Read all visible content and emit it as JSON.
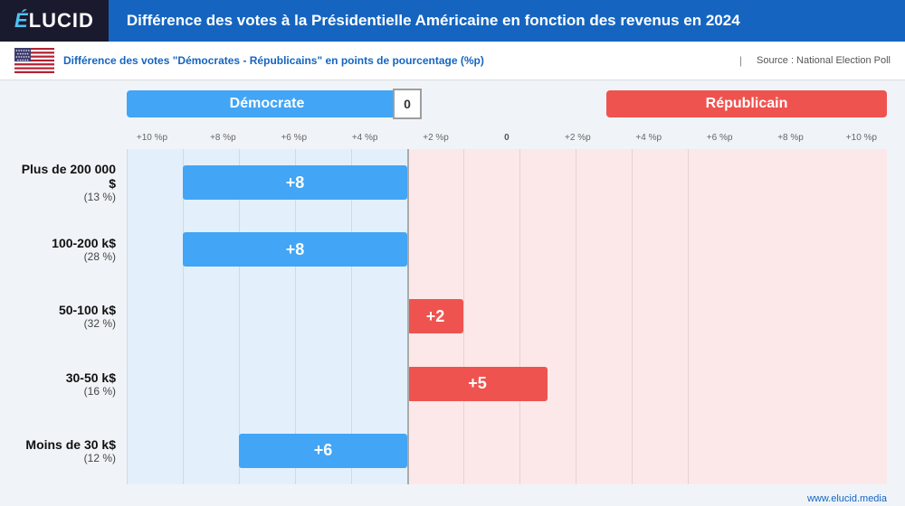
{
  "header": {
    "logo": "ÉLUCID",
    "logo_accent": "É",
    "title": "Différence des votes à la Présidentielle Américaine en fonction des revenus en 2024"
  },
  "subtitle": {
    "text": "Différence des votes \"Démocrates - Républicains\" en points de pourcentage (%p)",
    "source": "Source : National Election Poll"
  },
  "legend": {
    "democrat": "Démocrate",
    "republican": "Républicain",
    "zero": "0"
  },
  "axis": {
    "labels": [
      "+10 %p",
      "+8 %p",
      "+6 %p",
      "+4 %p",
      "+2 %p",
      "0",
      "+2 %p",
      "+4 %p",
      "+6 %p",
      "+8 %p",
      "+10 %p"
    ]
  },
  "bars": [
    {
      "label": "Plus de 200 000 $",
      "sublabel": "(13 %)",
      "value": "+8",
      "side": "democrat",
      "pct": 8
    },
    {
      "label": "100-200 k$",
      "sublabel": "(28 %)",
      "value": "+8",
      "side": "democrat",
      "pct": 8
    },
    {
      "label": "50-100 k$",
      "sublabel": "(32 %)",
      "value": "+2",
      "side": "republican",
      "pct": 2
    },
    {
      "label": "30-50 k$",
      "sublabel": "(16 %)",
      "value": "+5",
      "side": "republican",
      "pct": 5
    },
    {
      "label": "Moins de 30 k$",
      "sublabel": "(12 %)",
      "value": "+6",
      "side": "democrat",
      "pct": 6
    }
  ],
  "footer": {
    "website": "www.elucid.media"
  },
  "colors": {
    "democrat": "#42a5f5",
    "republican": "#ef5350",
    "header_bg": "#1a1a2e",
    "title_bg": "#1565c0",
    "bg_democrat": "#e3f0fb",
    "bg_republican": "#fce8e8"
  }
}
